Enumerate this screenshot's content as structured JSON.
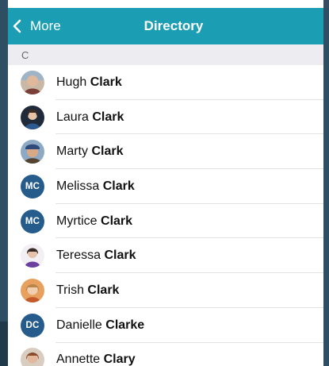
{
  "navbar": {
    "back_label": "More",
    "title": "Directory",
    "color": "#1b9eb4"
  },
  "section": {
    "letter": "C"
  },
  "contacts": [
    {
      "first": "Hugh",
      "last": "Clark",
      "avatar": "photo"
    },
    {
      "first": "Laura",
      "last": "Clark",
      "avatar": "photo"
    },
    {
      "first": "Marty",
      "last": "Clark",
      "avatar": "photo"
    },
    {
      "first": "Melissa",
      "last": "Clark",
      "avatar": "initials",
      "initials": "MC"
    },
    {
      "first": "Myrtice",
      "last": "Clark",
      "avatar": "initials",
      "initials": "MC"
    },
    {
      "first": "Teressa",
      "last": "Clark",
      "avatar": "photo"
    },
    {
      "first": "Trish",
      "last": "Clark",
      "avatar": "photo"
    },
    {
      "first": "Danielle",
      "last": "Clarke",
      "avatar": "initials",
      "initials": "DC"
    },
    {
      "first": "Annette",
      "last": "Clary",
      "avatar": "photo"
    }
  ],
  "colors": {
    "initials_avatar": "#265c8c"
  }
}
